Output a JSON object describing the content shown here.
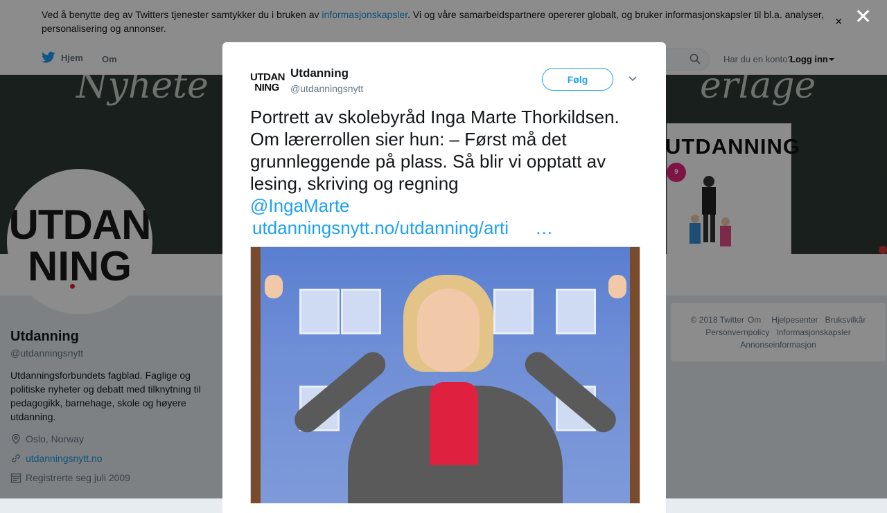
{
  "cookie": {
    "text_before": "Ved å benytte deg av Twitters tjenester samtykker du i bruken av ",
    "link": "informasjonskapsler",
    "text_after": ". Vi og våre samarbeidspartnere opererer globalt, og bruker informasjonskapsler til bl.a. analyser, personalisering og annonser.",
    "close": "×"
  },
  "nav": {
    "home": "Hjem",
    "about": "Om",
    "account_question": "Har du en konto?",
    "login": "Logg inn"
  },
  "banner": {
    "chalk_left": "Nyhete",
    "chalk_right": "erlage",
    "magazine_title": "UTDANNING",
    "magazine_badge": "9"
  },
  "profile": {
    "avatar_line1": "UTDAN",
    "avatar_line2": "NING",
    "name": "Utdanning",
    "handle": "@utdanningsnytt",
    "bio": "Utdanningsforbundets fagblad. Faglige og politiske nyheter og debatt med tilknytning til pedagogikk, barnehage, skole og høyere utdanning.",
    "location": "Oslo, Norway",
    "website": "utdanningsnytt.no",
    "joined": "Registrerte seg juli 2009"
  },
  "footer": {
    "line1": [
      "© 2018 Twitter",
      "Om",
      "Hjelpesenter",
      "Bruksvilkår"
    ],
    "line2": [
      "Personvernpolicy",
      "Informasjonskapsler"
    ],
    "line3": [
      "Annonseinformasjon"
    ]
  },
  "overlay": {
    "close": "✕"
  },
  "tweet": {
    "avatar_line1": "UTDAN",
    "avatar_line2": "NING",
    "name": "Utdanning",
    "handle": "@utdanningsnytt",
    "follow": "Følg",
    "text": "Portrett av skolebyråd Inga Marte Thorkildsen. Om lærerrollen sier hun: –  Først må det grunnleggende på plass. Så blir vi opptatt av lesing, skriving og regning",
    "mention": "@IngaMarte",
    "link": "utdanningsnytt.no/utdanning/arti",
    "ellipsis": "…"
  },
  "colors": {
    "accent": "#1da1f2",
    "link": "#1b95e0",
    "overlay": "rgba(0,0,0,0.45)"
  },
  "icons": [
    "twitter-bird-icon",
    "search-icon",
    "caret-down-icon",
    "close-icon",
    "chevron-down-icon",
    "location-icon",
    "link-icon",
    "calendar-icon"
  ]
}
